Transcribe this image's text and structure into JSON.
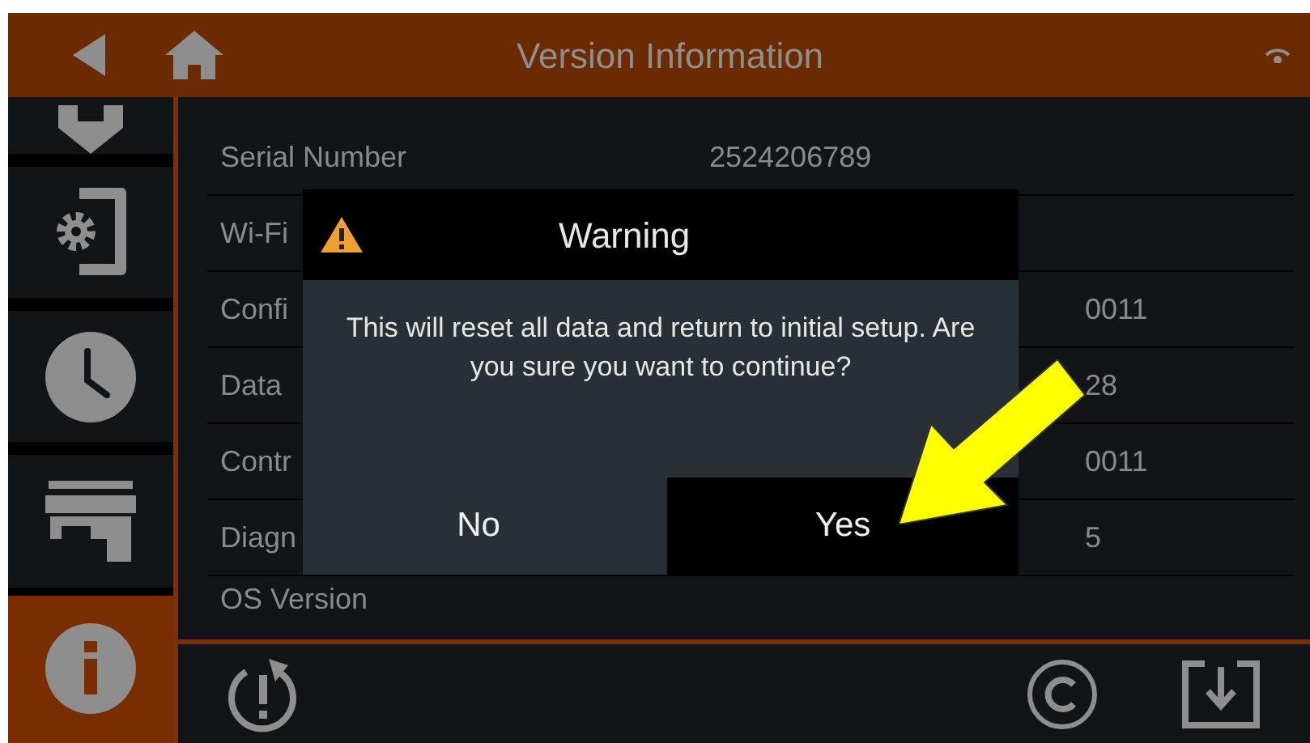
{
  "header": {
    "title": "Version Information"
  },
  "sidebar": {
    "items": [
      {
        "kind": "download",
        "selected": false
      },
      {
        "kind": "settings",
        "selected": false
      },
      {
        "kind": "clock",
        "selected": false
      },
      {
        "kind": "store",
        "selected": false
      },
      {
        "kind": "info",
        "selected": true
      }
    ]
  },
  "rows": [
    {
      "label": "Serial Number",
      "value": "2524206789"
    },
    {
      "label": "Wi-Fi"
    },
    {
      "label": "Confi",
      "value": "0011"
    },
    {
      "label": "Data",
      "value": "28"
    },
    {
      "label": "Contr",
      "value": "0011"
    },
    {
      "label": "Diagn",
      "value": "5"
    },
    {
      "label": "OS Version"
    }
  ],
  "dialog": {
    "title": "Warning",
    "message": "This will reset all data and return to initial setup. Are you sure you want to continue?",
    "buttons": [
      {
        "label": "No",
        "selected": false
      },
      {
        "label": "Yes",
        "selected": true
      }
    ]
  }
}
